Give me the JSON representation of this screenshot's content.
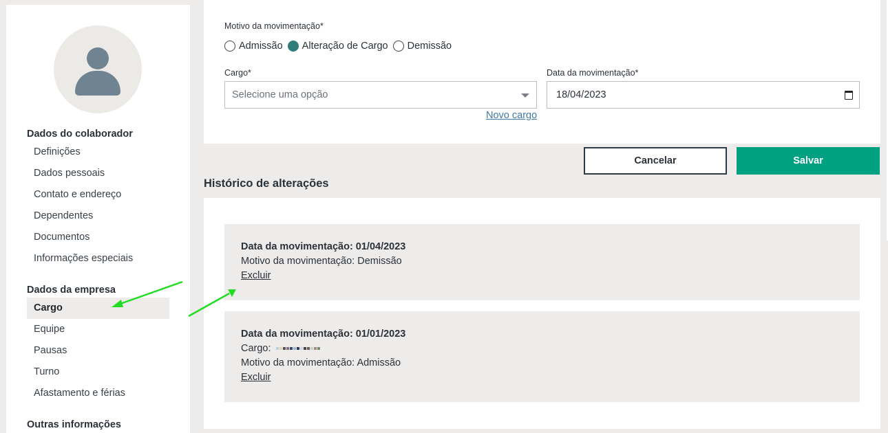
{
  "sidebar": {
    "sections": [
      {
        "title": "Dados do colaborador",
        "items": [
          "Definições",
          "Dados pessoais",
          "Contato e endereço",
          "Dependentes",
          "Documentos",
          "Informações especiais"
        ]
      },
      {
        "title": "Dados da empresa",
        "items": [
          "Cargo",
          "Equipe",
          "Pausas",
          "Turno",
          "Afastamento e férias"
        ]
      },
      {
        "title": "Outras informações",
        "items": []
      }
    ],
    "active_item": "Cargo"
  },
  "form": {
    "motivo_label": "Motivo da movimentação*",
    "radios": [
      {
        "label": "Admissão",
        "checked": false
      },
      {
        "label": "Alteração de Cargo",
        "checked": true
      },
      {
        "label": "Demissão",
        "checked": false
      }
    ],
    "cargo_label": "Cargo*",
    "cargo_placeholder": "Selecione uma opção",
    "novo_cargo_link": "Novo cargo",
    "data_label": "Data da movimentação*",
    "data_value": "18/04/2023"
  },
  "actions": {
    "cancel_label": "Cancelar",
    "save_label": "Salvar"
  },
  "history": {
    "title": "Histórico de alterações",
    "entries": [
      {
        "date_line": "Data da movimentação: 01/04/2023",
        "motivo_line": "Motivo da movimentação: Demissão",
        "delete_label": "Excluir"
      },
      {
        "date_line": "Data da movimentação: 01/01/2023",
        "cargo_label": "Cargo:",
        "motivo_line": "Motivo da movimentação: Admissão",
        "delete_label": "Excluir"
      }
    ]
  },
  "colors": {
    "accent": "#00a083",
    "radio_checked": "#2e7d7b",
    "link": "#3f7aa6",
    "annotation_arrow": "#22dd22",
    "background": "#edecea"
  }
}
